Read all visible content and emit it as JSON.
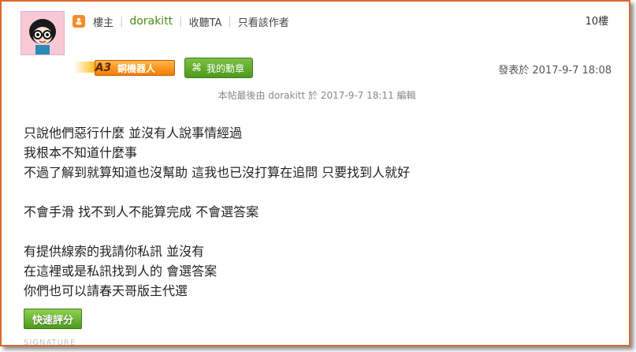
{
  "post_header": {
    "role_label": "樓主",
    "username": "dorakitt",
    "listen_label": "收聽TA",
    "author_only_label": "只看該作者",
    "floor_label": "10樓"
  },
  "badges": {
    "robot_badge_text": "銅機器人",
    "robot_level": "A3",
    "medal_label": "我的勳章"
  },
  "post_date": "發表於 2017-9-7 18:08",
  "edit_note": "本帖最後由 dorakitt 於 2017-9-7 18:11 編輯",
  "content": {
    "lines": [
      "只說他們惡行什麼 並沒有人說事情經過",
      "我根本不知道什麼事",
      "不過了解到就算知道也沒幫助 這我也已沒打算在追問 只要找到人就好",
      "",
      "不會手滑 找不到人不能算完成 不會選答案",
      "",
      "有提供線索的我請你私訊 並沒有",
      "在這裡或是私訊找到人的 會選答案",
      "你們也可以請春天哥版主代選"
    ]
  },
  "rate_button_label": "快速評分",
  "signature_label": "SIGNATURE",
  "colors": {
    "frame_border": "#d9692a",
    "username": "#4a8c1c",
    "button_green": "#4e9a1f",
    "badge_orange": "#f57c00"
  },
  "icons": {
    "user_role": "user-icon",
    "medal": "command-icon",
    "avatar": "cartoon-girl-avatar"
  }
}
